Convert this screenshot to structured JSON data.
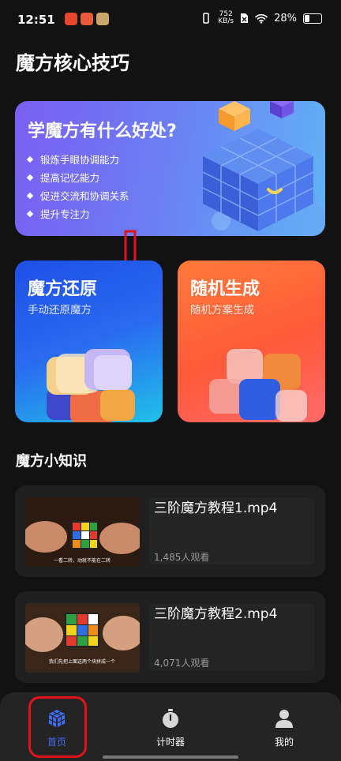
{
  "status_bar": {
    "time": "12:51",
    "speed_value": "752",
    "speed_unit": "KB/s",
    "battery": "28%"
  },
  "page": {
    "title": "魔方核心技巧"
  },
  "banner": {
    "title": "学魔方有什么好处?",
    "benefits": [
      "锻炼手眼协调能力",
      "提高记忆能力",
      "促进交流和协调关系",
      "提升专注力"
    ]
  },
  "cards": {
    "solve": {
      "title": "魔方还原",
      "subtitle": "手动还原魔方"
    },
    "random": {
      "title": "随机生成",
      "subtitle": "随机方案生成"
    }
  },
  "knowledge": {
    "title": "魔方小知识",
    "videos": [
      {
        "title": "三阶魔方教程1.mp4",
        "views": "1,485人观看",
        "caption": "一看二转，动就不能在二转"
      },
      {
        "title": "三阶魔方教程2.mp4",
        "views": "4,071人观看",
        "caption": "我们先把上面这两个块拼成一个"
      }
    ]
  },
  "tabbar": {
    "home": "首页",
    "timer": "计时器",
    "mine": "我的",
    "active_color": "#3f6cf5"
  },
  "colors": {
    "highlight": "#e0131b",
    "arrow": "#e0131b"
  }
}
